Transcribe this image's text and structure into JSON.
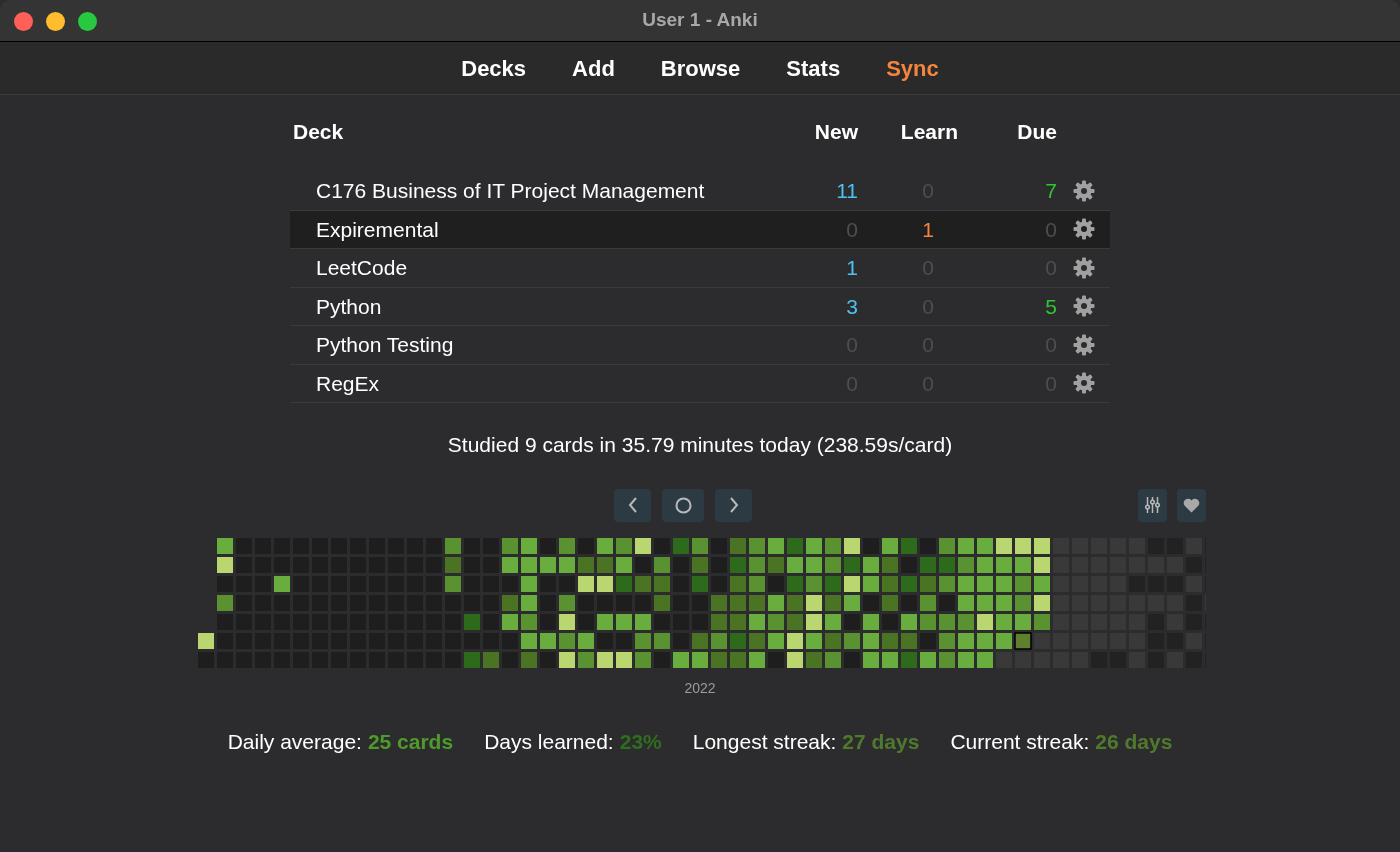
{
  "window": {
    "title": "User 1 - Anki"
  },
  "toolbar": [
    {
      "label": "Decks",
      "highlighted": false
    },
    {
      "label": "Add",
      "highlighted": false
    },
    {
      "label": "Browse",
      "highlighted": false
    },
    {
      "label": "Stats",
      "highlighted": false
    },
    {
      "label": "Sync",
      "highlighted": true
    }
  ],
  "deck_table": {
    "columns": [
      "Deck",
      "New",
      "Learn",
      "Due"
    ],
    "rows": [
      {
        "name": "C176 Business of IT Project Management",
        "selected": false,
        "new": {
          "value": "11",
          "muted": false
        },
        "learn": {
          "value": "0",
          "muted": true
        },
        "due": {
          "value": "7",
          "muted": false
        }
      },
      {
        "name": "Expiremental",
        "selected": true,
        "new": {
          "value": "0",
          "muted": true
        },
        "learn": {
          "value": "1",
          "muted": false
        },
        "due": {
          "value": "0",
          "muted": true
        }
      },
      {
        "name": "LeetCode",
        "selected": false,
        "new": {
          "value": "1",
          "muted": false
        },
        "learn": {
          "value": "0",
          "muted": true
        },
        "due": {
          "value": "0",
          "muted": true
        }
      },
      {
        "name": "Python",
        "selected": false,
        "new": {
          "value": "3",
          "muted": false
        },
        "learn": {
          "value": "0",
          "muted": true
        },
        "due": {
          "value": "5",
          "muted": false
        }
      },
      {
        "name": "Python Testing",
        "selected": false,
        "new": {
          "value": "0",
          "muted": true
        },
        "learn": {
          "value": "0",
          "muted": true
        },
        "due": {
          "value": "0",
          "muted": true
        }
      },
      {
        "name": "RegEx",
        "selected": false,
        "new": {
          "value": "0",
          "muted": true
        },
        "learn": {
          "value": "0",
          "muted": true
        },
        "due": {
          "value": "0",
          "muted": true
        }
      }
    ]
  },
  "studied_summary": "Studied 9 cards in 35.79 minutes today (238.59s/card)",
  "heatmap": {
    "year_label": "2022"
  },
  "stats": [
    {
      "label": "Daily average:",
      "value": "25 cards",
      "color": "#4e9a2a"
    },
    {
      "label": "Days learned:",
      "value": "23%",
      "color": "#2f6e1e"
    },
    {
      "label": "Longest streak:",
      "value": "27 days",
      "color": "#4f7a2c"
    },
    {
      "label": "Current streak:",
      "value": "26 days",
      "color": "#4f7a2c"
    }
  ]
}
